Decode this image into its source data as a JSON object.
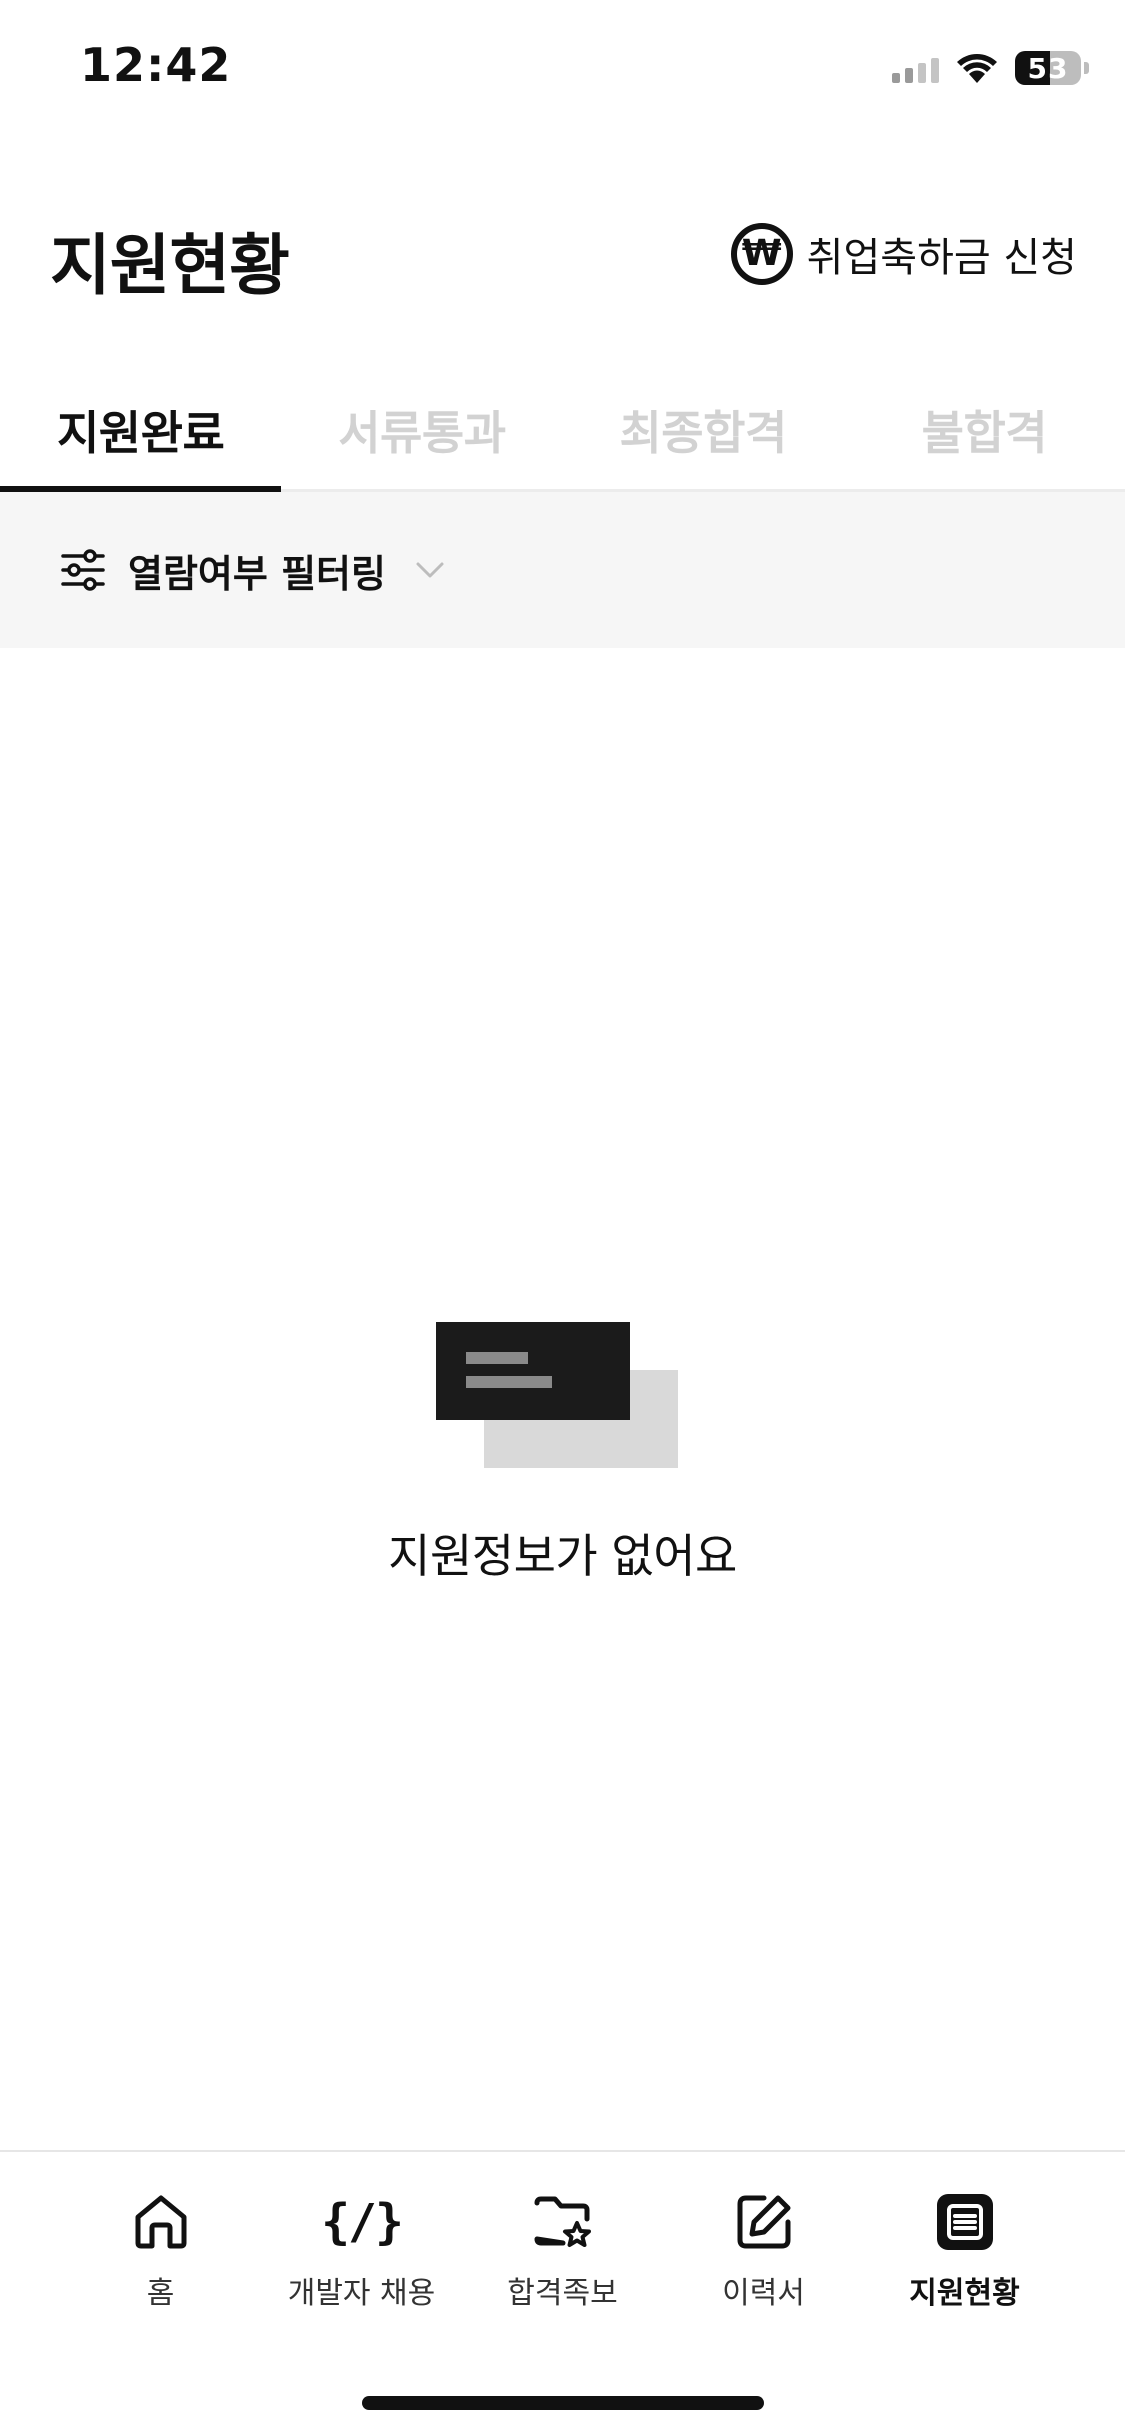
{
  "status_bar": {
    "time": "12:42",
    "battery": "53"
  },
  "header": {
    "title": "지원현황",
    "bonus_label": "취업축하금 신청",
    "bonus_icon": "won-icon"
  },
  "tabs": [
    {
      "label": "지원완료",
      "active": true
    },
    {
      "label": "서류통과",
      "active": false
    },
    {
      "label": "최종합격",
      "active": false
    },
    {
      "label": "불합격",
      "active": false
    }
  ],
  "filter": {
    "label": "열람여부 필터링",
    "icon": "sliders-icon"
  },
  "empty_state": {
    "message": "지원정보가 없어요",
    "illustration": "cards-illustration"
  },
  "bottom_nav": {
    "items": [
      {
        "label": "홈",
        "icon": "home-icon",
        "active": false
      },
      {
        "label": "개발자 채용",
        "icon": "code-icon",
        "glyph": "{/}",
        "active": false
      },
      {
        "label": "합격족보",
        "icon": "folder-star-icon",
        "active": false
      },
      {
        "label": "이력서",
        "icon": "edit-icon",
        "active": false
      },
      {
        "label": "지원현황",
        "icon": "list-icon",
        "active": true
      }
    ]
  },
  "colors": {
    "primary": "#111111",
    "inactive_tab": "#d2d2d2",
    "filter_bg": "#f6f6f6",
    "divider": "#ececec",
    "illustration_back": "#d9d9d9",
    "illustration_lines": "#8a8a8a"
  }
}
